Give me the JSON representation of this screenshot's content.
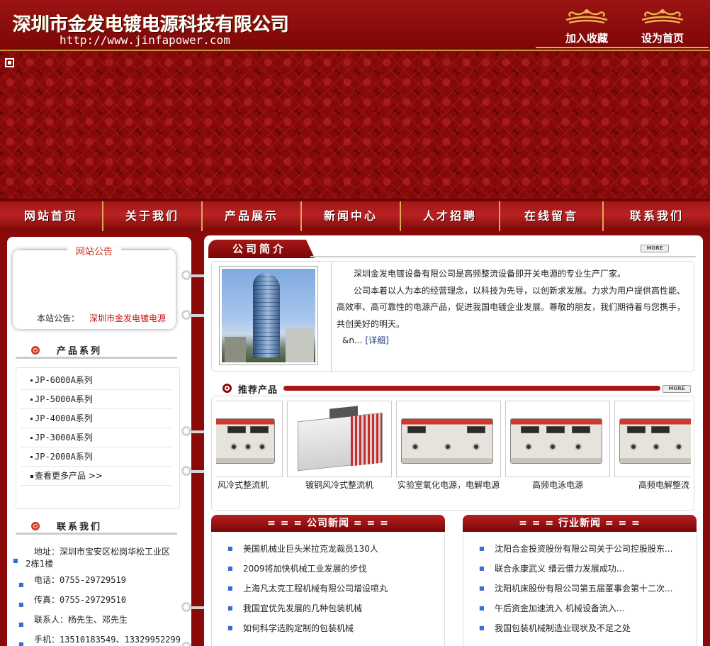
{
  "header": {
    "title": "深圳市金发电镀电源科技有限公司",
    "url": "http://www.jinfapower.com",
    "bookmark_label": "加入收藏",
    "homepage_label": "设为首页"
  },
  "nav": [
    "网站首页",
    "关于我们",
    "产品展示",
    "新闻中心",
    "人才招聘",
    "在线留言",
    "联系我们"
  ],
  "notice": {
    "title": "网站公告",
    "label": "本站公告：",
    "text": "深圳市金发电镀电源"
  },
  "products": {
    "title": "产品系列",
    "items": [
      "JP-6000A系列",
      "JP-5000A系列",
      "JP-4000A系列",
      "JP-3000A系列",
      "JP-2000A系列"
    ],
    "more": "查看更多产品 >>"
  },
  "contact": {
    "title": "联系我们",
    "address_line1": "地址：深圳市宝安区松岗华松工业区",
    "address_line2": "2栋1楼",
    "phone": "电话：0755-29729519",
    "fax": "传真：0755-29729510",
    "person": "联系人：杨先生、邓先生",
    "mobile": "手机：13510183549、13329952299"
  },
  "intro": {
    "title": "公司简介",
    "more_label": "MORE",
    "para1": "深圳金发电镀设备有限公司是高频整流设备即开关电源的专业生产厂家。",
    "para2": "公司本着以人为本的经营理念，以科技为先导，以创新求发展。力求为用户提供高性能、高效率、高可靠性的电源产品，促进我国电镀企业发展。尊敬的朋友，我们期待着与您携手，共创美好的明天。",
    "ellipsis": "&n...",
    "detail_link": "[详细]"
  },
  "recommended": {
    "title": "推荐产品",
    "more_label": "MORE",
    "items": [
      {
        "name": "风冷式整流机"
      },
      {
        "name": "镀铜风冷式整流机"
      },
      {
        "name": "实验室氧化电源，电解电源"
      },
      {
        "name": "高频电泳电源"
      },
      {
        "name": "高频电解整流"
      }
    ]
  },
  "company_news": {
    "title": "= = = 公司新闻 = = =",
    "items": [
      "美国机械业巨头米拉克龙裁员130人",
      "2009将加快机械工业发展的步伐",
      "上海凡太克工程机械有限公司增设喷丸",
      "我国宜优先发展的几种包装机械",
      "如何科学选购定制的包装机械"
    ]
  },
  "industry_news": {
    "title": "= = = 行业新闻 = = =",
    "items": [
      "沈阳合金投资股份有限公司关于公司控股股东...",
      "联合永康武义 缙云借力发展成功...",
      "沈阳机床股份有限公司第五届董事会第十二次...",
      "午后资金加速流入 机械设备流入...",
      "我国包装机械制造业现状及不足之处"
    ]
  },
  "colors": {
    "primary_red": "#8a0a0a",
    "accent_gold": "#e7b84e",
    "link_red": "#c41414",
    "link_blue": "#1d3d7a"
  }
}
